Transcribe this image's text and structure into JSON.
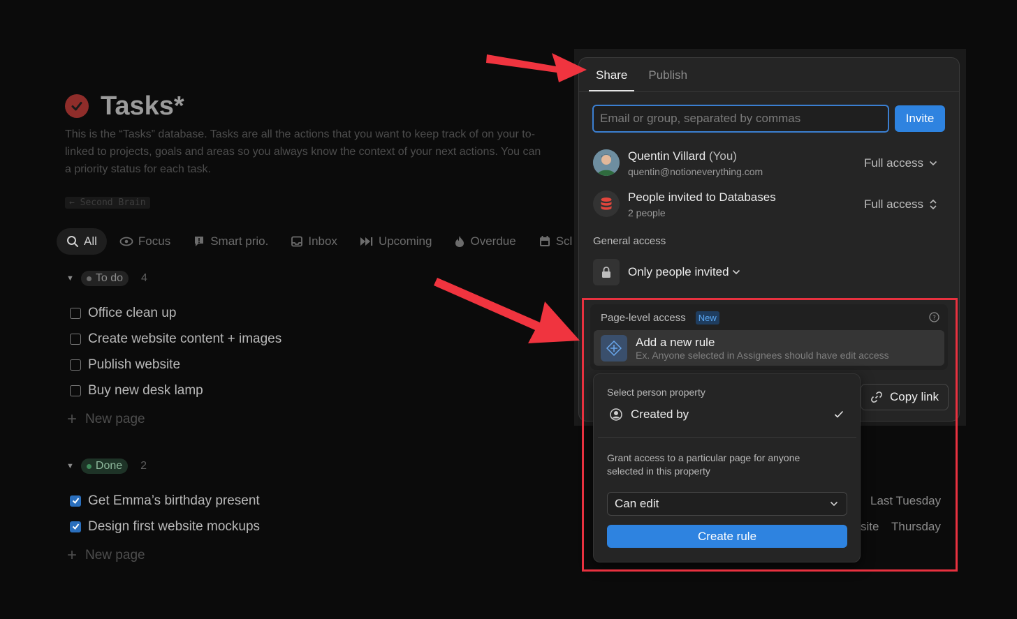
{
  "page": {
    "title": "Tasks*",
    "description": [
      "This is the “Tasks” database. Tasks are all the actions that you want to keep track of on your to-",
      "linked to projects, goals and areas so you always know the context of your next actions. You can",
      "a priority status for each task."
    ],
    "breadcrumb": "← Second Brain"
  },
  "views": [
    {
      "label": "All",
      "icon": "search-icon"
    },
    {
      "label": "Focus",
      "icon": "eye-icon"
    },
    {
      "label": "Smart prio.",
      "icon": "alert-icon"
    },
    {
      "label": "Inbox",
      "icon": "inbox-icon"
    },
    {
      "label": "Upcoming",
      "icon": "fast-forward-icon"
    },
    {
      "label": "Overdue",
      "icon": "fire-icon"
    },
    {
      "label": "Scl",
      "icon": "calendar-icon"
    }
  ],
  "groups": {
    "todo": {
      "label": "To do",
      "count": "4",
      "tasks": [
        "Office clean up",
        "Create website content + images",
        "Publish website",
        "Buy new desk lamp"
      ],
      "new_page": "New page"
    },
    "done": {
      "label": "Done",
      "count": "2",
      "tasks": [
        "Get Emma’s birthday present",
        "Design first website mockups"
      ],
      "new_page": "New page",
      "row_dates": [
        "Last Tuesday",
        "Thursday"
      ],
      "row_partial": "site"
    }
  },
  "share": {
    "tabs": [
      "Share",
      "Publish"
    ],
    "input_placeholder": "Email or group, separated by commas",
    "invite_label": "Invite",
    "members": [
      {
        "name": "Quentin Villard",
        "suffix": "(You)",
        "sub": "quentin@notioneverything.com",
        "access": "Full access"
      },
      {
        "name": "People invited to Databases",
        "suffix": "",
        "sub": "2 people",
        "access": "Full access"
      }
    ],
    "general_access_label": "General access",
    "general_access_value": "Only people invited",
    "page_level": {
      "label": "Page-level access",
      "badge": "New",
      "rule_title": "Add a new rule",
      "rule_sub": "Ex. Anyone selected in Assignees should have edit access"
    },
    "copy_link": "Copy link"
  },
  "dropdown": {
    "label": "Select person property",
    "option": "Created by",
    "help": "Grant access to a particular page for anyone selected in this property",
    "permission": "Can edit",
    "create_label": "Create rule"
  },
  "colors": {
    "accent": "#2e83e0",
    "annotation": "#e8313f"
  }
}
